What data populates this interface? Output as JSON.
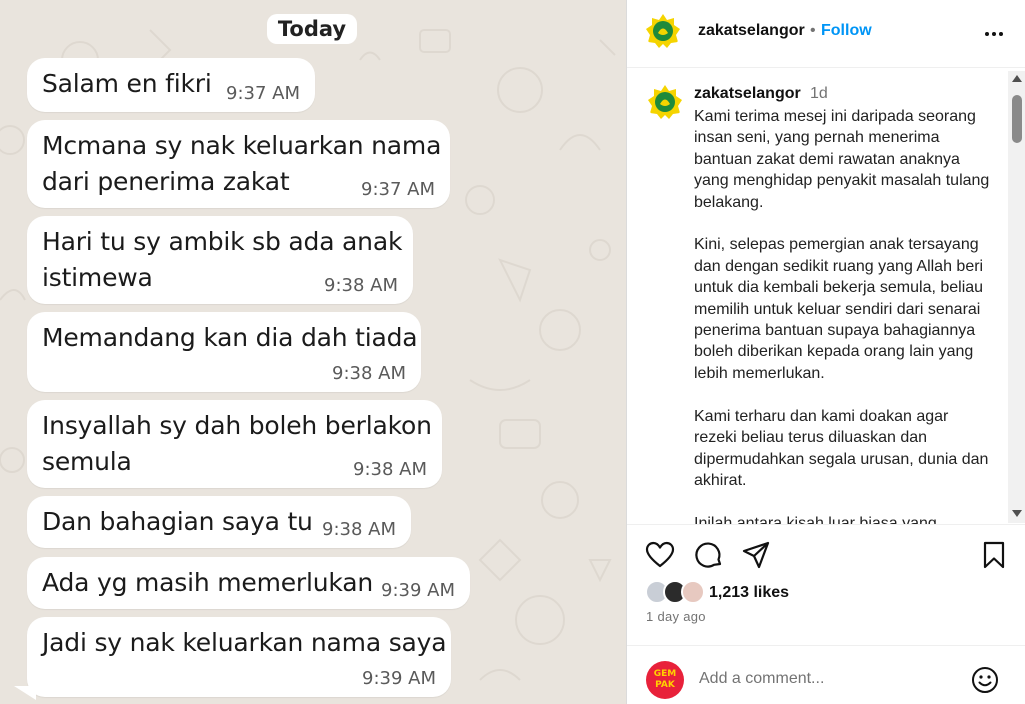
{
  "chat": {
    "date_label": "Today",
    "messages": [
      {
        "text": "Salam en fikri",
        "time": "9:37 AM"
      },
      {
        "text": "Mcmana sy nak keluarkan nama\ndari penerima zakat",
        "time": "9:37 AM"
      },
      {
        "text": "Hari tu sy ambik sb ada anak\nistimewa",
        "time": "9:38 AM"
      },
      {
        "text": "Memandang kan dia dah tiada",
        "time": "9:38 AM"
      },
      {
        "text": "Insyallah sy dah boleh berlakon\nsemula",
        "time": "9:38 AM"
      },
      {
        "text": "Dan bahagian saya tu",
        "time": "9:38 AM"
      },
      {
        "text": "Ada yg masih memerlukan",
        "time": "9:39 AM"
      },
      {
        "text": "Jadi sy nak keluarkan nama saya",
        "time": "9:39 AM"
      }
    ]
  },
  "post": {
    "header": {
      "username": "zakatselangor",
      "separator": "•",
      "follow_label": "Follow",
      "more_icon": "more-horizontal-icon"
    },
    "caption": {
      "username": "zakatselangor",
      "time_ago": "1d",
      "text": "Kami terima mesej ini daripada seorang insan seni, yang pernah menerima bantuan zakat demi rawatan anaknya yang menghidap penyakit masalah tulang belakang.\n\nKini, selepas pemergian anak tersayang dan dengan sedikit ruang yang Allah beri untuk dia kembali bekerja semula, beliau memilih untuk keluar sendiri dari senarai penerima bantuan supaya bahagiannya boleh diberikan kepada orang lain yang lebih memerlukan.\n\nKami terharu dan kami doakan agar rezeki beliau terus diluaskan dan dipermudahkan segala urusan, dunia dan akhirat.\n\nInilah antara kisah luar biasa yang"
    },
    "likes": "1,213 likes",
    "date": "1 day ago",
    "comment": {
      "placeholder": "Add a comment...",
      "avatar_text": "GEM PAK"
    },
    "colors": {
      "follow": "#0095f6",
      "logo_yellow": "#f5d400",
      "logo_green": "#1f8a3b",
      "gempak_red": "#e8213a"
    }
  }
}
